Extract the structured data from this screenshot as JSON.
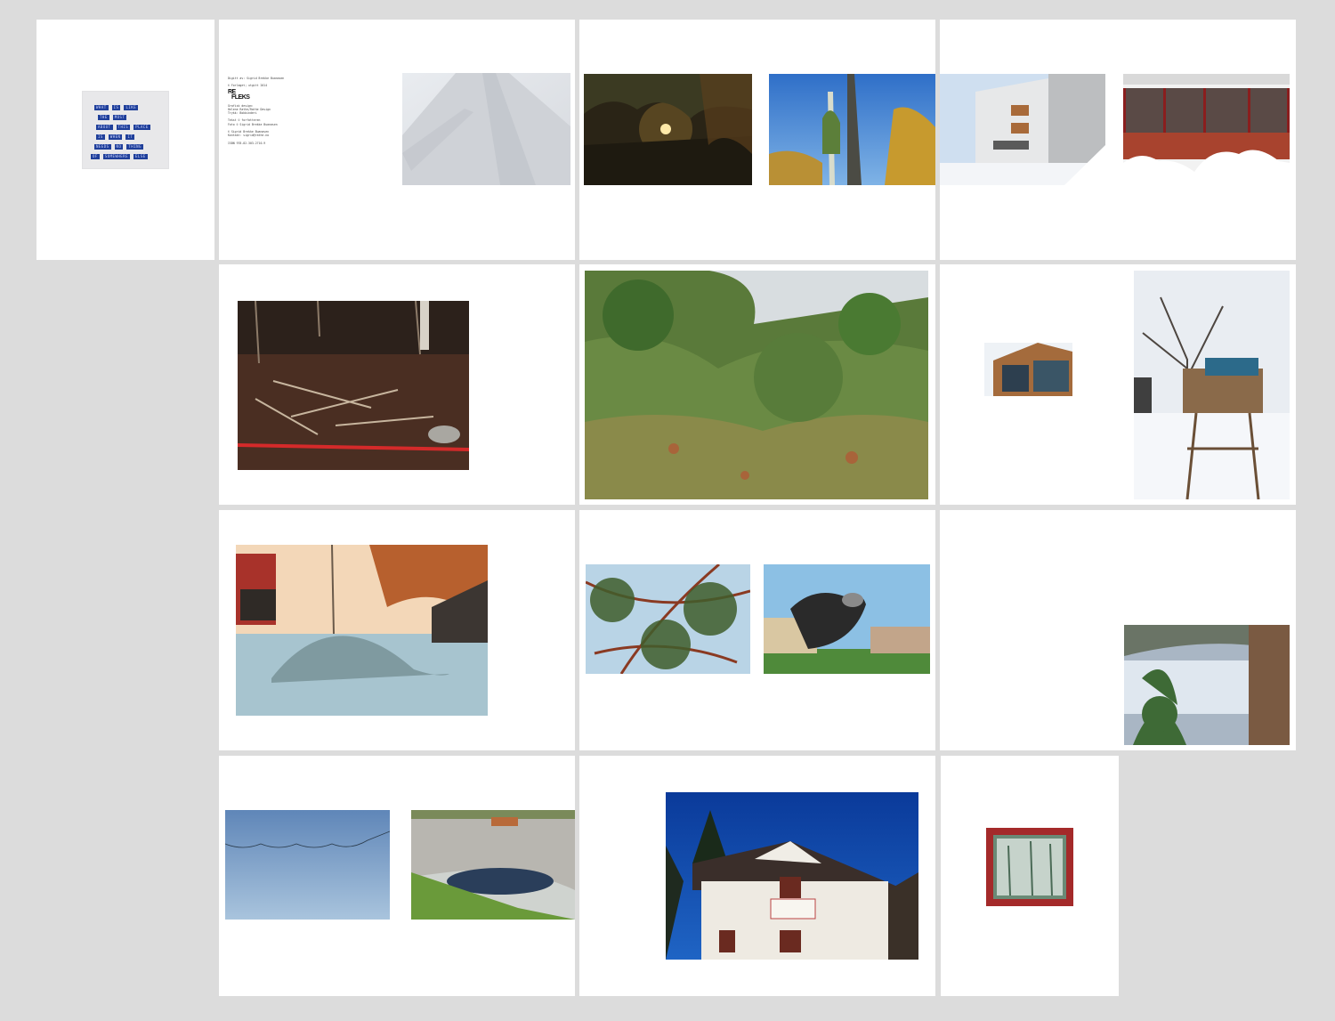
{
  "spread_1": {
    "tape_label": {
      "lines": [
        [
          "WHAT",
          "IS",
          "LIKE"
        ],
        [
          "THE",
          "MOST"
        ],
        [
          "ABOUT",
          "THIS",
          "PLACE"
        ],
        [
          "IS",
          "WHEN",
          "IT"
        ],
        [
          "NEEDS",
          "NO",
          "THING"
        ],
        [
          "OF",
          "SOMEWHERE",
          "ELSE"
        ]
      ]
    }
  },
  "colophon": {
    "blocks": [
      [
        "Digitt av: Sigrid Brekke Buanasen"
      ],
      [
        "© Forlaget; utgitt 2014"
      ],
      [
        "Grafisk design:",
        "Helene Rathe/Rathe Design",
        "Trykk: Bokbinderi"
      ],
      [
        "Tekst © forfatteren",
        "Foto © Sigrid Brekke Buanasen"
      ],
      [
        "© Sigrid Brekke Buanasen",
        "Kontakt: sigrid@rathe.no"
      ],
      [
        "ISBN 978-82-303-2710-9"
      ]
    ],
    "logo_line1": "RE",
    "logo_line2": "FLEKS"
  },
  "colors": {
    "background": "#dcdcdc",
    "page": "#ffffff",
    "tape": "#1f3f9a"
  },
  "photos": [
    "snowy-road",
    "sunset-trees",
    "birch-sky",
    "white-building",
    "brick-building",
    "forest-floor-red-hose",
    "overgrown-bushes",
    "modern-house-small",
    "treehouse-snow",
    "construction-gravel-pile",
    "pine-branches",
    "sculpture-lawn",
    "window-plant-reflection",
    "blue-sky-wires",
    "rock-pond",
    "white-house-blue-sky",
    "framed-window-red"
  ]
}
